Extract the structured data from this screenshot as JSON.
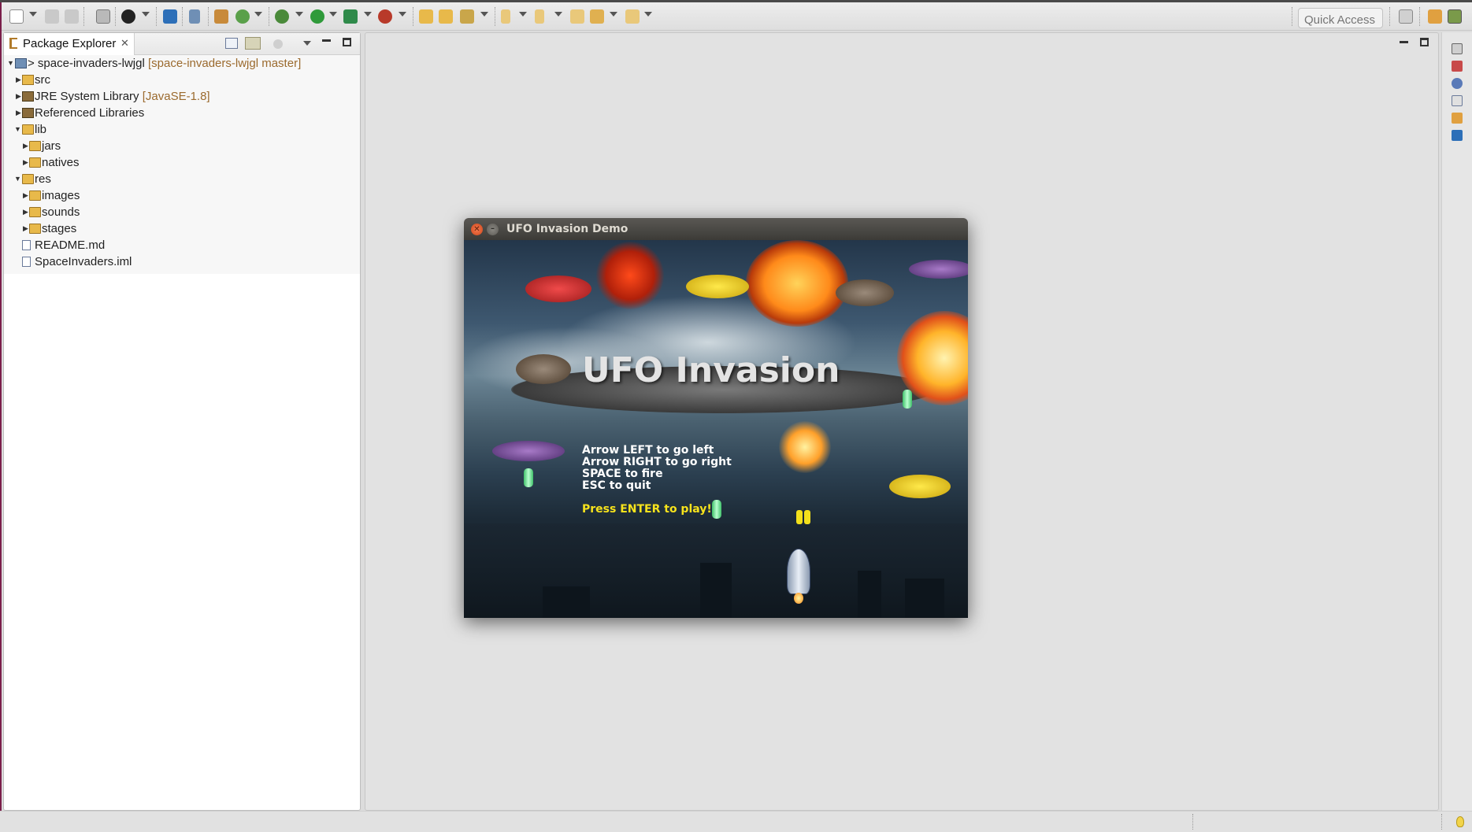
{
  "toolbar": {
    "quick_access_placeholder": "Quick Access",
    "icons": [
      "new-icon",
      "save-icon",
      "save-all-icon",
      "print-icon",
      "profile-icon",
      "console-icon",
      "skip-breakpoints-icon",
      "new-java-project-icon",
      "new-package-icon",
      "debug-icon",
      "run-icon",
      "coverage-icon",
      "external-tools-icon",
      "open-type-icon",
      "open-folder-icon",
      "search-icon",
      "next-annotation-icon",
      "previous-annotation-icon",
      "last-edit-location-icon",
      "back-icon",
      "forward-icon",
      "perspective-open-icon",
      "debug-perspective-icon",
      "java-perspective-icon"
    ]
  },
  "package_explorer": {
    "tab_label": "Package Explorer",
    "tree": [
      {
        "label": "> space-invaders-lwjgl",
        "decoration": "[space-invaders-lwjgl master]",
        "icon": "project-icon",
        "expanded": true
      },
      {
        "label": "src",
        "decoration": "",
        "icon": "source-folder-icon",
        "expanded": false
      },
      {
        "label": "JRE System Library",
        "decoration": "[JavaSE-1.8]",
        "icon": "library-icon",
        "expanded": false
      },
      {
        "label": "Referenced Libraries",
        "decoration": "",
        "icon": "library-icon",
        "expanded": false
      },
      {
        "label": "lib",
        "decoration": "",
        "icon": "folder-icon",
        "expanded": true
      },
      {
        "label": "jars",
        "decoration": "",
        "icon": "folder-icon",
        "expanded": false
      },
      {
        "label": "natives",
        "decoration": "",
        "icon": "folder-icon",
        "expanded": false
      },
      {
        "label": "res",
        "decoration": "",
        "icon": "folder-icon",
        "expanded": true
      },
      {
        "label": "images",
        "decoration": "",
        "icon": "folder-icon",
        "expanded": false
      },
      {
        "label": "sounds",
        "decoration": "",
        "icon": "folder-icon",
        "expanded": false
      },
      {
        "label": "stages",
        "decoration": "",
        "icon": "folder-icon",
        "expanded": false
      },
      {
        "label": "README.md",
        "decoration": "",
        "icon": "file-icon"
      },
      {
        "label": "SpaceInvaders.iml",
        "decoration": "",
        "icon": "file-icon"
      }
    ]
  },
  "game_window": {
    "title": "UFO Invasion Demo",
    "game_title": "UFO Invasion",
    "instructions": [
      "Arrow LEFT to go left",
      "Arrow RIGHT to go right",
      "SPACE to fire",
      "ESC to quit"
    ],
    "press_enter": "Press ENTER to play!"
  },
  "colors": {
    "accent": "#f7e31c",
    "decoration": "#9b6a2e",
    "editor_bg": "#e2e2e2"
  }
}
